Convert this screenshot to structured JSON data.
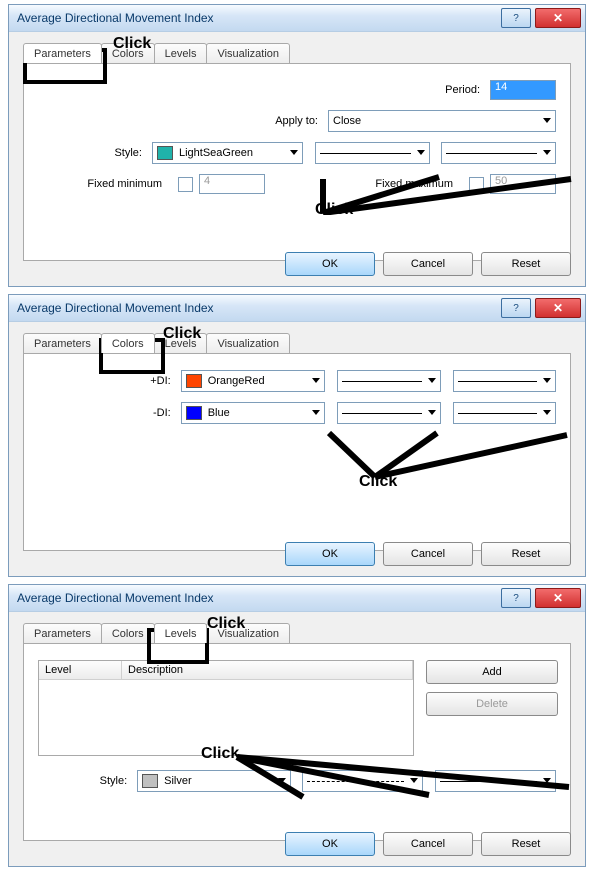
{
  "dialogs": [
    {
      "title": "Average Directional Movement Index",
      "tabs": [
        "Parameters",
        "Colors",
        "Levels",
        "Visualization"
      ],
      "active_tab": "Parameters",
      "period_label": "Period:",
      "period_value": "14",
      "apply_label": "Apply to:",
      "apply_value": "Close",
      "style_label": "Style:",
      "style_color_name": "LightSeaGreen",
      "style_color_hex": "#20B2AA",
      "fixed_min_label": "Fixed minimum",
      "fixed_min_value": "4",
      "fixed_max_label": "Fixed maximum",
      "fixed_max_value": "50",
      "annot_click": "Click"
    },
    {
      "title": "Average Directional Movement Index",
      "tabs": [
        "Parameters",
        "Colors",
        "Levels",
        "Visualization"
      ],
      "active_tab": "Colors",
      "di_plus_label": "+DI:",
      "di_plus_color_name": "OrangeRed",
      "di_plus_color_hex": "#FF4500",
      "di_minus_label": "-DI:",
      "di_minus_color_name": "Blue",
      "di_minus_color_hex": "#0000FF",
      "annot_click": "Click"
    },
    {
      "title": "Average Directional Movement Index",
      "tabs": [
        "Parameters",
        "Colors",
        "Levels",
        "Visualization"
      ],
      "active_tab": "Levels",
      "col_level": "Level",
      "col_desc": "Description",
      "add_label": "Add",
      "delete_label": "Delete",
      "style_label": "Style:",
      "style_color_name": "Silver",
      "style_color_hex": "#C0C0C0",
      "annot_click": "Click"
    }
  ],
  "buttons": {
    "ok": "OK",
    "cancel": "Cancel",
    "reset": "Reset"
  }
}
